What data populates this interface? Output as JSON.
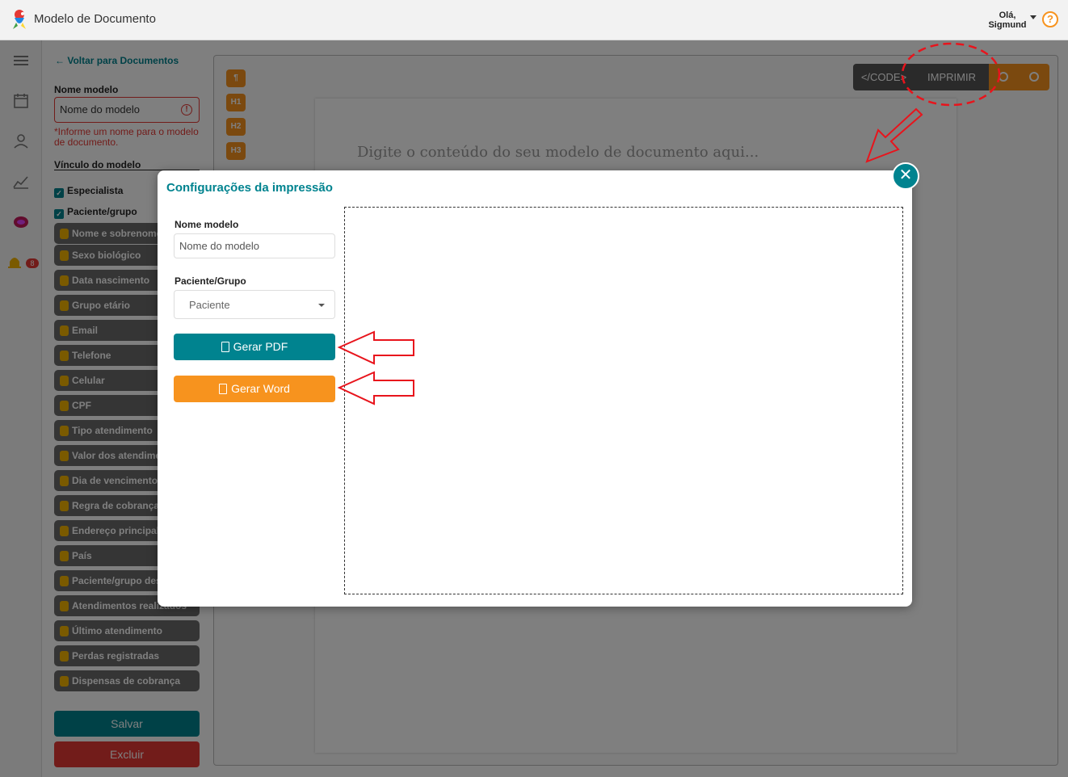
{
  "header": {
    "app_title": "Modelo de Documento",
    "greeting": "Olá,",
    "user_name": "Sigmund",
    "help_glyph": "?"
  },
  "rail": {
    "icons": [
      "menu-icon",
      "calendar-icon",
      "user-icon",
      "chart-icon",
      "brain-icon",
      "bell-icon"
    ],
    "bell_badge": "8"
  },
  "panel": {
    "back_label": "Voltar para Documentos",
    "name_label": "Nome modelo",
    "name_placeholder": "Nome do modelo",
    "name_error": "*Informe um nome para o modelo de documento.",
    "link_label": "Vínculo do modelo",
    "checkboxes": [
      {
        "label": "Especialista",
        "checked": true
      },
      {
        "label": "Paciente/grupo",
        "checked": true
      }
    ],
    "chips": [
      "Nome e sobrenome",
      "Sexo biológico",
      "Data nascimento",
      "Grupo etário",
      "Email",
      "Telefone",
      "Celular",
      "CPF",
      "Tipo atendimento",
      "Valor dos atendimentos",
      "Dia de vencimentos",
      "Regra de cobrança",
      "Endereço principal",
      "País",
      "Paciente/grupo desde",
      "Atendimentos realizados",
      "Último atendimento",
      "Perdas registradas",
      "Dispensas de cobrança"
    ],
    "save_label": "Salvar",
    "delete_label": "Excluir"
  },
  "editor": {
    "tools": [
      "¶",
      "H1",
      "H2",
      "H3"
    ],
    "code_label": "</CODE>",
    "print_label": "IMPRIMIR",
    "placeholder": "Digite o conteúdo do seu modelo de documento aqui..."
  },
  "modal": {
    "title": "Configurações da impressão",
    "close_glyph": "✕",
    "name_label": "Nome modelo",
    "name_placeholder": "Nome do modelo",
    "patient_label": "Paciente/Grupo",
    "patient_value": "Paciente",
    "pdf_label": "Gerar PDF",
    "word_label": "Gerar Word"
  },
  "colors": {
    "teal": "#00838f",
    "orange": "#f7931e",
    "error_red": "#e53935",
    "annotation_red": "#e8141c"
  }
}
